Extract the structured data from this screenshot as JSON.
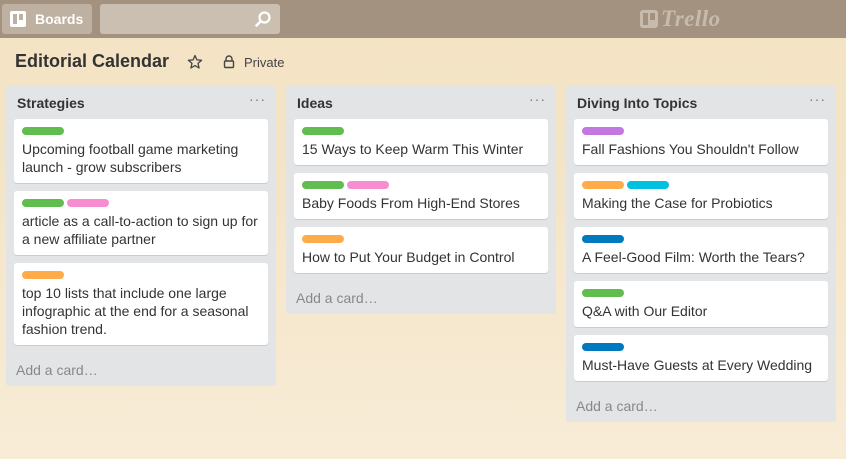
{
  "header": {
    "boards_label": "Boards",
    "search_placeholder": "",
    "logo_text": "Trello"
  },
  "board": {
    "title": "Editorial Calendar",
    "privacy": "Private"
  },
  "colors": {
    "green": "#61bd4f",
    "pink": "#f78dd1",
    "orange": "#ffab4a",
    "purple": "#c377e0",
    "sky": "#00c2e0",
    "blue": "#0079bf"
  },
  "lists": [
    {
      "name": "Strategies",
      "menu": "···",
      "add_card": "Add a card…",
      "cards": [
        {
          "labels": [
            "green"
          ],
          "title": "Upcoming football game marketing launch - grow subscribers"
        },
        {
          "labels": [
            "green",
            "pink"
          ],
          "title": "article as a call-to-action to sign up for a new affiliate partner"
        },
        {
          "labels": [
            "orange"
          ],
          "title": "top 10 lists that include one large infographic at the end for a seasonal fashion trend."
        }
      ]
    },
    {
      "name": "Ideas",
      "menu": "···",
      "add_card": "Add a card…",
      "cards": [
        {
          "labels": [
            "green"
          ],
          "title": "15 Ways to Keep Warm This Winter"
        },
        {
          "labels": [
            "green",
            "pink"
          ],
          "title": "Baby Foods From High-End Stores"
        },
        {
          "labels": [
            "orange"
          ],
          "title": "How to Put Your Budget in Control"
        }
      ]
    },
    {
      "name": "Diving Into Topics",
      "menu": "···",
      "add_card": "Add a card…",
      "cards": [
        {
          "labels": [
            "purple"
          ],
          "title": "Fall Fashions You Shouldn't Follow"
        },
        {
          "labels": [
            "orange",
            "sky"
          ],
          "title": "Making the Case for Probiotics"
        },
        {
          "labels": [
            "blue"
          ],
          "title": "A Feel-Good Film: Worth the Tears?"
        },
        {
          "labels": [
            "green"
          ],
          "title": "Q&A with Our Editor"
        },
        {
          "labels": [
            "blue"
          ],
          "title": "Must-Have Guests at Every Wedding"
        }
      ]
    }
  ]
}
